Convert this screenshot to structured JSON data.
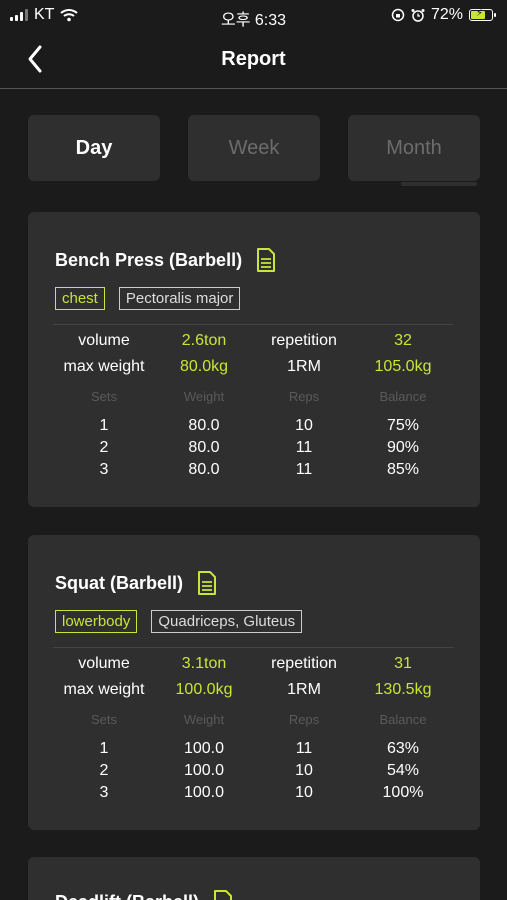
{
  "status_bar": {
    "carrier": "KT",
    "time": "오후 6:33",
    "battery": "72%"
  },
  "header": {
    "title": "Report"
  },
  "tabs": [
    {
      "label": "Day"
    },
    {
      "label": "Week"
    },
    {
      "label": "Month"
    }
  ],
  "exercises": [
    {
      "name": "Bench Press (Barbell)",
      "tags": [
        "chest",
        "Pectoralis major"
      ],
      "summary": {
        "volume_label": "volume",
        "volume": "2.6ton",
        "repetition_label": "repetition",
        "repetition": "32",
        "max_label": "max weight",
        "max": "80.0kg",
        "rm_label": "1RM",
        "rm": "105.0kg"
      },
      "headers": [
        "Sets",
        "Weight",
        "Reps",
        "Balance"
      ],
      "sets": [
        [
          "1",
          "80.0",
          "10",
          "75%"
        ],
        [
          "2",
          "80.0",
          "11",
          "90%"
        ],
        [
          "3",
          "80.0",
          "11",
          "85%"
        ]
      ]
    },
    {
      "name": "Squat (Barbell)",
      "tags": [
        "lowerbody",
        "Quadriceps, Gluteus"
      ],
      "summary": {
        "volume_label": "volume",
        "volume": "3.1ton",
        "repetition_label": "repetition",
        "repetition": "31",
        "max_label": "max weight",
        "max": "100.0kg",
        "rm_label": "1RM",
        "rm": "130.5kg"
      },
      "headers": [
        "Sets",
        "Weight",
        "Reps",
        "Balance"
      ],
      "sets": [
        [
          "1",
          "100.0",
          "11",
          "63%"
        ],
        [
          "2",
          "100.0",
          "10",
          "54%"
        ],
        [
          "3",
          "100.0",
          "10",
          "100%"
        ]
      ]
    },
    {
      "name": "Deadlift (Barbell)"
    }
  ],
  "colors": {
    "accent": "#c8e636",
    "card": "#2f2f2f",
    "background": "#1b1b1b"
  }
}
